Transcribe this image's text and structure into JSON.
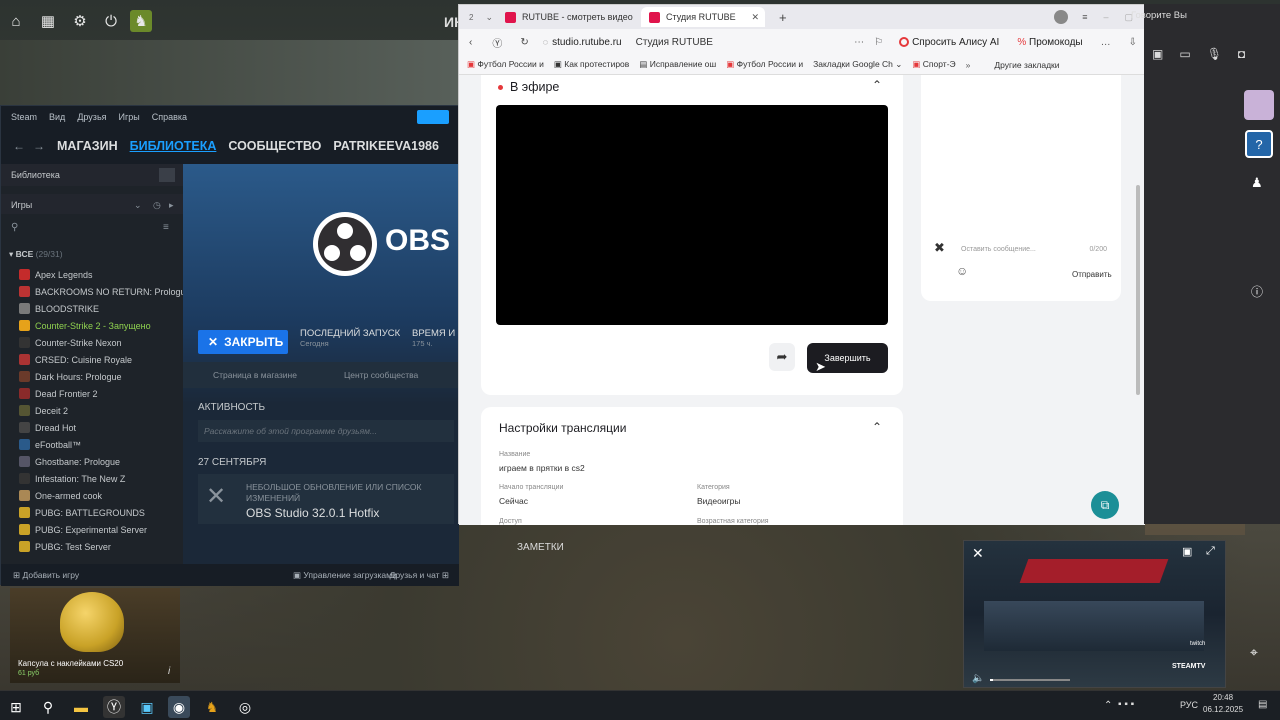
{
  "desktop": {
    "side_text": "ИН",
    "voice_label": "Говорите Вы",
    "capsule_title": "Капсула с наклейками CS20",
    "capsule_price": "61 руб"
  },
  "steam": {
    "menu": [
      "Steam",
      "Вид",
      "Друзья",
      "Игры",
      "Справка"
    ],
    "nav": [
      "МАГАЗИН",
      "БИБЛИОТЕКА",
      "СООБЩЕСТВО",
      "PATRIKEEVA1986"
    ],
    "library_label": "Библиотека",
    "games_label": "Игры",
    "all_label": "ВСЕ",
    "all_count": "(29/31)",
    "games": [
      {
        "name": "Apex Legends",
        "color": "#c42b2b"
      },
      {
        "name": "BACKROOMS NO RETURN: Prologu",
        "color": "#b33"
      },
      {
        "name": "BLOODSTRIKE",
        "color": "#7a7a7a"
      },
      {
        "name": "Counter-Strike 2 - Запущено",
        "color": "#e6a21a",
        "active": true
      },
      {
        "name": "Counter-Strike Nexon",
        "color": "#333"
      },
      {
        "name": "CRSED: Cuisine Royale",
        "color": "#a33"
      },
      {
        "name": "Dark Hours: Prologue",
        "color": "#6a3a2a"
      },
      {
        "name": "Dead Frontier 2",
        "color": "#8a2a2a"
      },
      {
        "name": "Deceit 2",
        "color": "#553"
      },
      {
        "name": "Dread Hot",
        "color": "#444"
      },
      {
        "name": "eFootball™",
        "color": "#2a5a8a"
      },
      {
        "name": "Ghostbane: Prologue",
        "color": "#556"
      },
      {
        "name": "Infestation: The New Z",
        "color": "#333"
      },
      {
        "name": "One-armed cook",
        "color": "#a85"
      },
      {
        "name": "PUBG: BATTLEGROUNDS",
        "color": "#c9a227"
      },
      {
        "name": "PUBG: Experimental Server",
        "color": "#c9a227"
      },
      {
        "name": "PUBG: Test Server",
        "color": "#c9a227"
      }
    ],
    "obs_logo_text": "OBS S",
    "close_button": "ЗАКРЫТЬ",
    "last_launch_label": "ПОСЛЕДНИЙ ЗАПУСК",
    "last_launch_value": "Сегодня",
    "playtime_label": "ВРЕМЯ И",
    "playtime_value": "175 ч.",
    "store_page": "Страница в магазине",
    "community_hub": "Центр сообщества",
    "activity_label": "АКТИВНОСТЬ",
    "activity_placeholder": "Расскажите об этой программе друзьям...",
    "date_label": "27 СЕНТЯБРЯ",
    "update_kind": "НЕБОЛЬШОЕ ОБНОВЛЕНИЕ ИЛИ СПИСОК ИЗМЕНЕНИЙ",
    "update_title": "OBS Studio 32.0.1 Hotfix",
    "notes_label": "ЗАМЕТКИ",
    "add_game": "Добавить игру",
    "downloads": "Управление загрузками",
    "friends_chat": "Друзья и чат"
  },
  "browser": {
    "tab_count": "2",
    "tabs": [
      "RUTUBE - смотреть видео",
      "Студия RUTUBE"
    ],
    "url_domain": "studio.rutube.ru",
    "url_title": "Студия RUTUBE",
    "alice_button": "Спросить Алису AI",
    "promo_button": "Промокоды",
    "bookmarks": [
      "Футбол России и",
      "Как протестиров",
      "Исправление ош",
      "Футбол России и",
      "Закладки Google Ch",
      "Спорт-Э"
    ],
    "other_bookmarks": "Другие закладки"
  },
  "rutube": {
    "live_label": "В эфире",
    "end_button": "Завершить",
    "chat_placeholder": "Оставить сообщение...",
    "chat_counter": "0/200",
    "send_button": "Отправить",
    "settings_title": "Настройки трансляции",
    "name_label": "Название",
    "name_value": "играем в прятки в cs2",
    "start_label": "Начало трансляции",
    "start_value": "Сейчас",
    "category_label": "Категория",
    "category_value": "Видеоигры",
    "access_label": "Доступ",
    "age_label": "Возрастная категория"
  },
  "pip": {
    "steamtv": "STEAMTV",
    "twitch": "twitch"
  },
  "taskbar": {
    "lang": "РУС",
    "time": "20:48",
    "date": "06.12.2025"
  },
  "colors": {
    "steam_blue": "#1a9fff",
    "rutube_dark": "#1c1c21",
    "live_dot": "#e5383b",
    "close_btn": "#1a73e8"
  }
}
